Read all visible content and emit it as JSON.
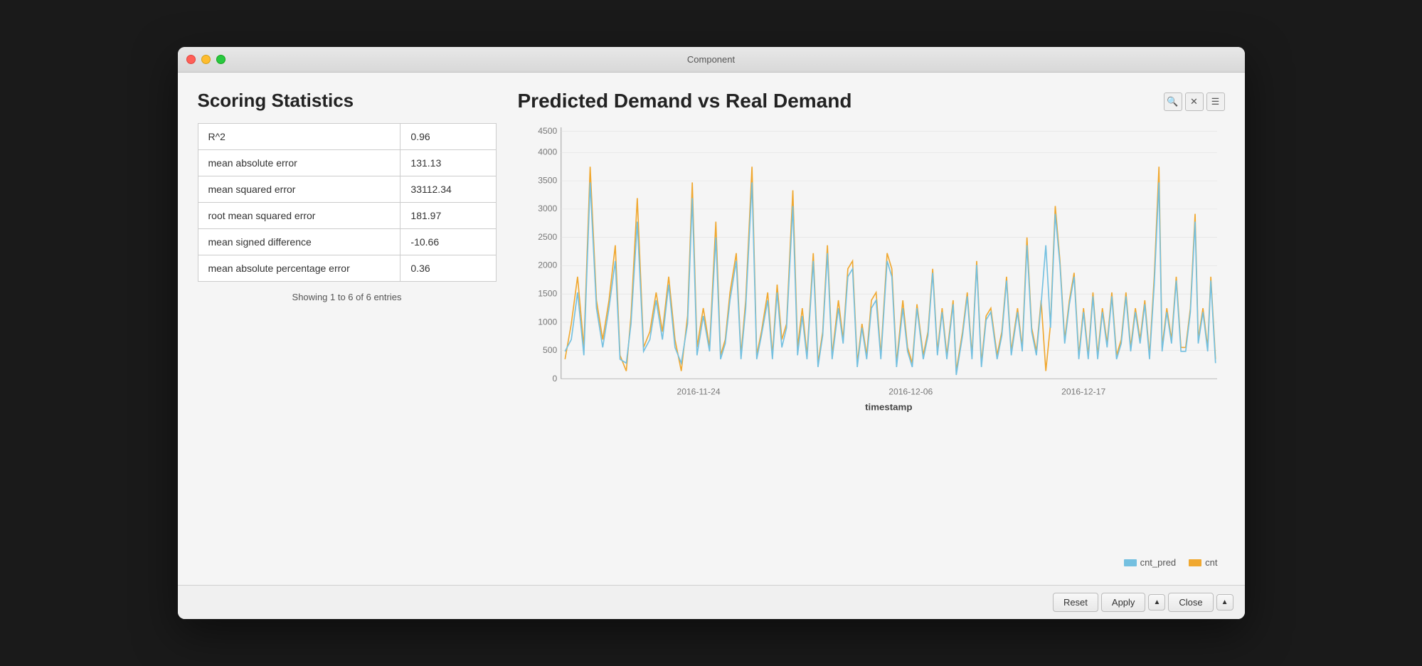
{
  "window": {
    "title": "Component"
  },
  "traffic_lights": {
    "red": "red",
    "yellow": "yellow",
    "green": "green"
  },
  "left": {
    "section_title": "Scoring Statistics",
    "table": {
      "rows": [
        {
          "metric": "R^2",
          "value": "0.96"
        },
        {
          "metric": "mean absolute error",
          "value": "131.13"
        },
        {
          "metric": "mean squared error",
          "value": "33112.34"
        },
        {
          "metric": "root mean squared error",
          "value": "181.97"
        },
        {
          "metric": "mean signed difference",
          "value": "-10.66"
        },
        {
          "metric": "mean absolute percentage error",
          "value": "0.36"
        }
      ]
    },
    "showing_text": "Showing 1 to 6 of 6 entries"
  },
  "chart": {
    "title": "Predicted Demand vs Real Demand",
    "x_label": "timestamp",
    "x_ticks": [
      "2016-11-24",
      "2016-12-06",
      "2016-12-17"
    ],
    "y_ticks": [
      "0",
      "500",
      "1000",
      "1500",
      "2000",
      "2500",
      "3000",
      "3500",
      "4000",
      "4500"
    ],
    "legend": [
      {
        "label": "cnt_pred",
        "color": "#74c0e0"
      },
      {
        "label": "cnt",
        "color": "#f0a830"
      }
    ],
    "icons": [
      "search",
      "close",
      "menu"
    ]
  },
  "bottom_bar": {
    "reset_label": "Reset",
    "apply_label": "Apply",
    "close_label": "Close"
  }
}
